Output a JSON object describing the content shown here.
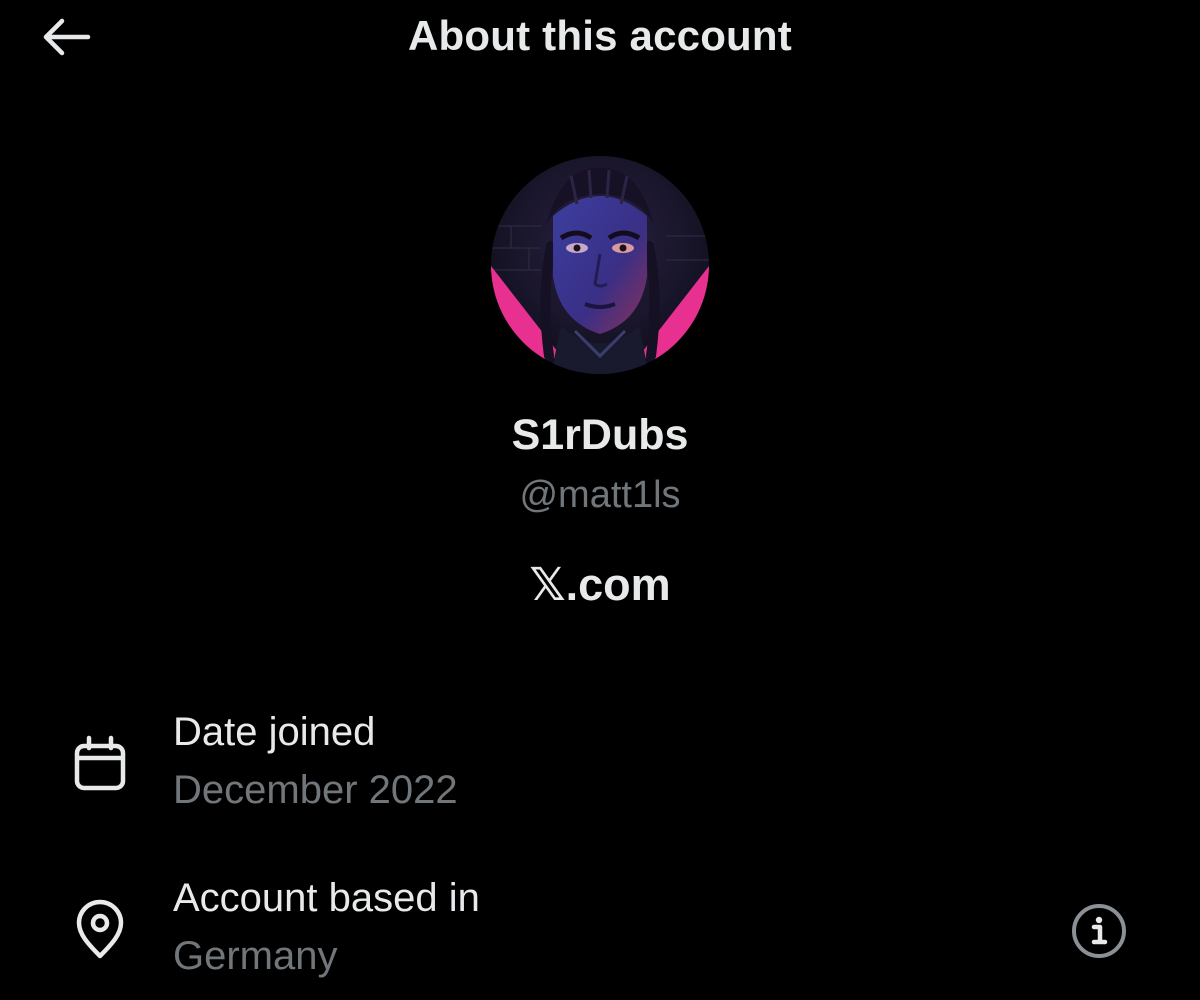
{
  "header": {
    "title": "About this account",
    "back_icon": "arrow-left-icon"
  },
  "profile": {
    "avatar_icon": "profile-avatar",
    "display_name": "S1rDubs",
    "handle": "@matt1ls",
    "site": "𝕏.com"
  },
  "details": {
    "date_joined": {
      "icon": "calendar-icon",
      "label": "Date joined",
      "value": "December 2022"
    },
    "location": {
      "icon": "location-pin-icon",
      "label": "Account based in",
      "value": "Germany",
      "info_icon": "info-icon"
    }
  },
  "colors": {
    "background": "#000000",
    "primary_text": "#e7e9ea",
    "secondary_text": "#71767b"
  }
}
